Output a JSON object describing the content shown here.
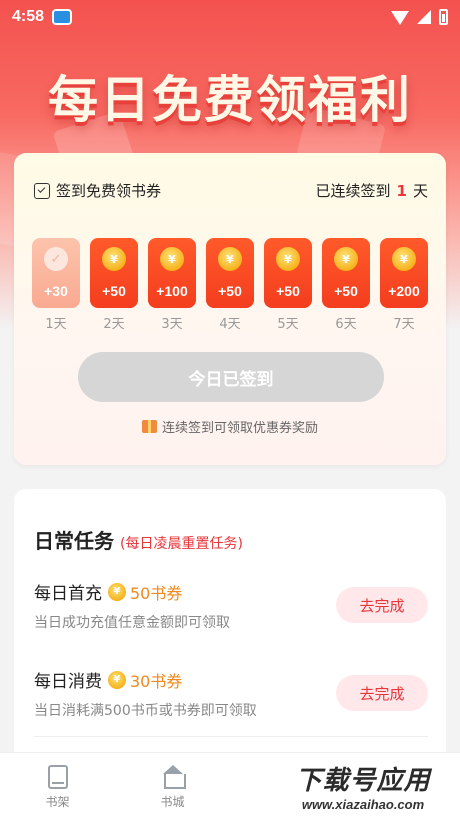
{
  "status_bar": {
    "time": "4:58"
  },
  "hero": {
    "title": "每日免费领福利"
  },
  "checkin": {
    "heading": "签到免费领书券",
    "streak_prefix": "已连续签到",
    "streak_count": "1",
    "streak_suffix": "天",
    "days": [
      {
        "amount": "+30",
        "label": "1天",
        "checked": true
      },
      {
        "amount": "+50",
        "label": "2天",
        "checked": false
      },
      {
        "amount": "+100",
        "label": "3天",
        "checked": false
      },
      {
        "amount": "+50",
        "label": "4天",
        "checked": false
      },
      {
        "amount": "+50",
        "label": "5天",
        "checked": false
      },
      {
        "amount": "+50",
        "label": "6天",
        "checked": false
      },
      {
        "amount": "+200",
        "label": "7天",
        "checked": false
      }
    ],
    "coin_symbol": "¥",
    "check_symbol": "✓",
    "button_label": "今日已签到",
    "tip": "连续签到可领取优惠券奖励"
  },
  "tasks": {
    "title": "日常任务",
    "subtitle": "(每日凌晨重置任务)",
    "items": [
      {
        "name": "每日首充",
        "reward": "50书券",
        "desc": "当日成功充值任意金额即可领取",
        "button": "去完成"
      },
      {
        "name": "每日消费",
        "reward": "30书券",
        "desc": "当日消耗满500书币或书券即可领取",
        "button": "去完成"
      }
    ]
  },
  "bottom_nav": {
    "items": [
      {
        "label": "书架",
        "icon": "bookshelf-icon"
      },
      {
        "label": "书城",
        "icon": "bookstore-icon"
      }
    ]
  },
  "watermark": {
    "main": "下载号应用",
    "url": "www.xiazaihao.com"
  },
  "colors": {
    "accent": "#e8363a",
    "day_card": "#f43d1f",
    "button_disabled": "#d6d6d6"
  }
}
